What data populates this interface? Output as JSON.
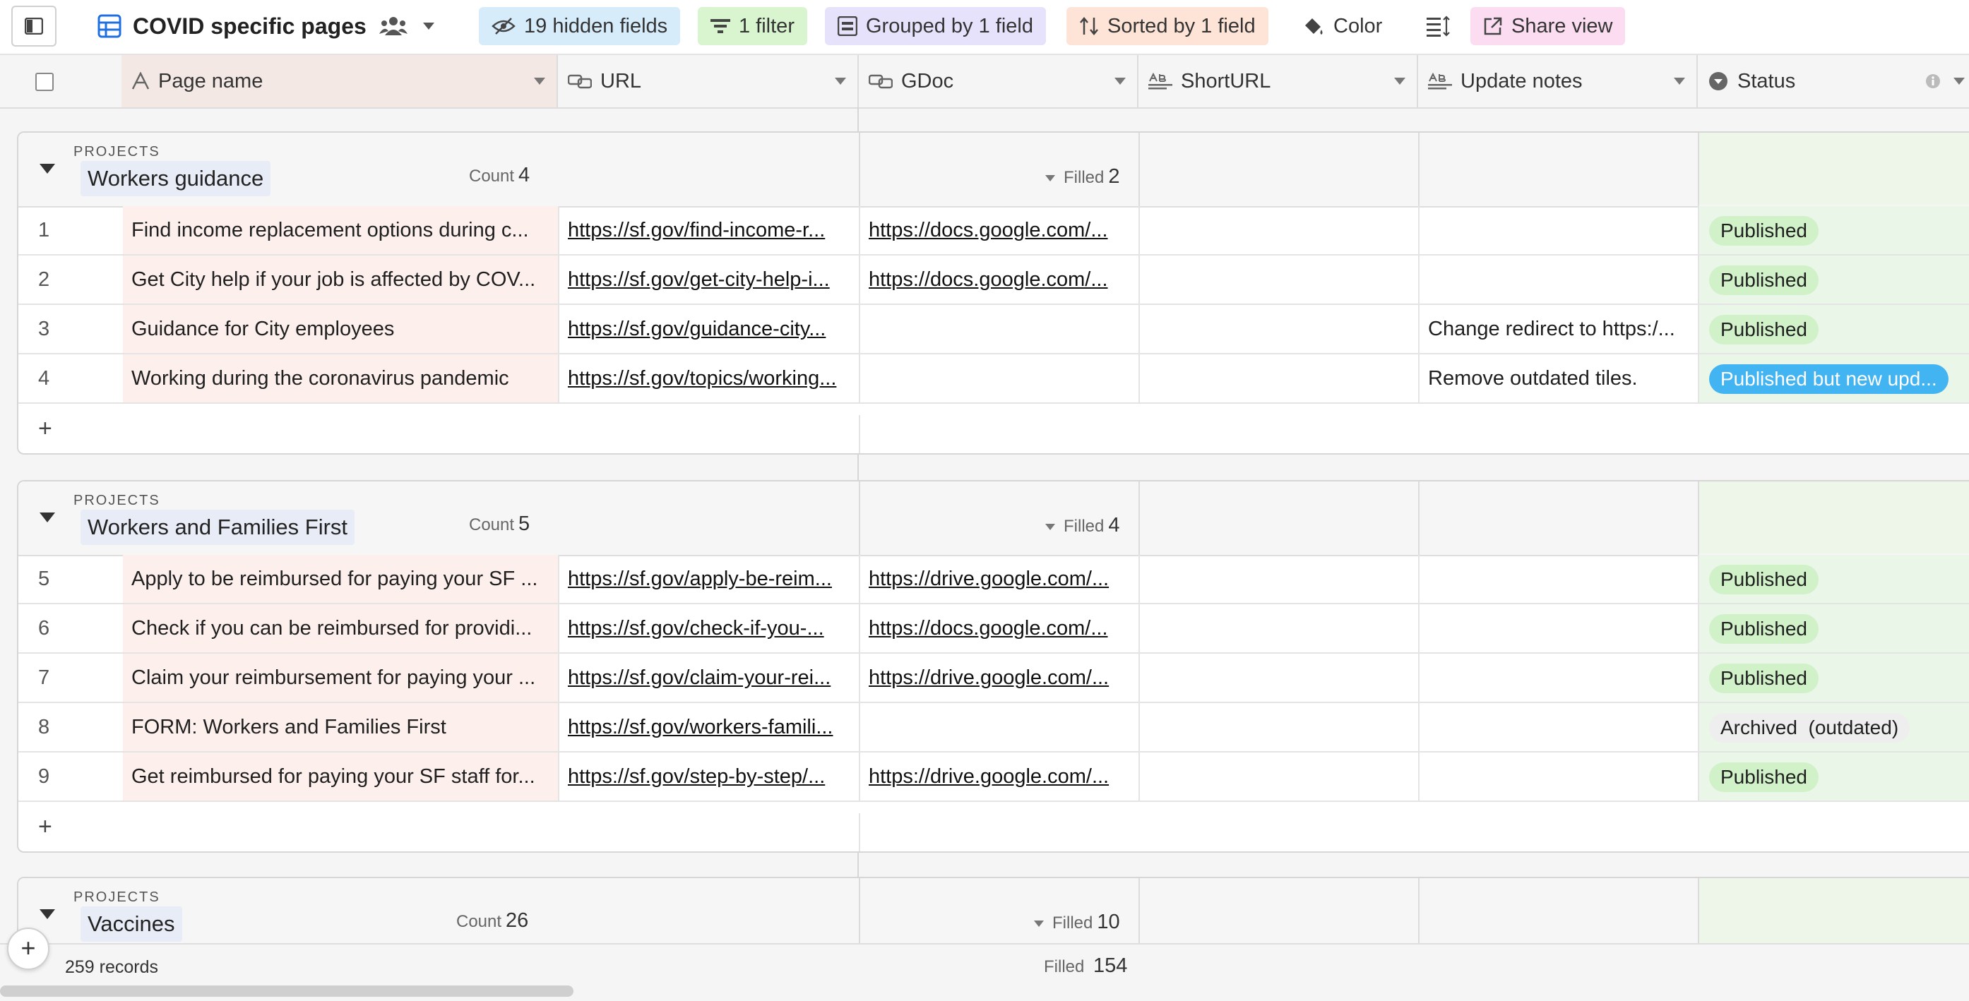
{
  "toolbar": {
    "view_title": "COVID specific pages",
    "hidden_fields": "19 hidden fields",
    "filter": "1 filter",
    "grouped": "Grouped by 1 field",
    "sorted": "Sorted by 1 field",
    "color": "Color",
    "share": "Share view"
  },
  "columns": {
    "page_name": "Page name",
    "url": "URL",
    "gdoc": "GDoc",
    "shorturl": "ShortURL",
    "update_notes": "Update notes",
    "status": "Status"
  },
  "colors": {
    "published": "#d1f1c9",
    "published_new": "#43b4f2",
    "archived": "#eeeeee",
    "hidden_fields_bg": "#d6ecfb",
    "filter_bg": "#d9f5d0",
    "grouped_bg": "#e7e2fb",
    "sorted_bg": "#fde4d6",
    "share_bg": "#fbdcf0"
  },
  "groups": [
    {
      "label": "PROJECTS",
      "name": "Workers guidance",
      "count_label": "Count",
      "count": "4",
      "filled_label": "Filled",
      "filled": "2",
      "rows": [
        {
          "num": "1",
          "page": "Find income replacement options during c...",
          "url": "https://sf.gov/find-income-r...",
          "gdoc": "https://docs.google.com/...",
          "notes": "",
          "status": "Published",
          "status_kind": "published"
        },
        {
          "num": "2",
          "page": "Get City help if your job is affected by COV...",
          "url": "https://sf.gov/get-city-help-i...",
          "gdoc": "https://docs.google.com/...",
          "notes": "",
          "status": "Published",
          "status_kind": "published"
        },
        {
          "num": "3",
          "page": "Guidance for City employees",
          "url": "https://sf.gov/guidance-city...",
          "gdoc": "",
          "notes": "Change redirect to https:/...",
          "status": "Published",
          "status_kind": "published"
        },
        {
          "num": "4",
          "page": "Working during the coronavirus pandemic",
          "url": "https://sf.gov/topics/working...",
          "gdoc": "",
          "notes": "Remove outdated tiles.",
          "status": "Published but new upd...",
          "status_kind": "published_new"
        }
      ]
    },
    {
      "label": "PROJECTS",
      "name": "Workers and Families First",
      "count_label": "Count",
      "count": "5",
      "filled_label": "Filled",
      "filled": "4",
      "rows": [
        {
          "num": "5",
          "page": "Apply to be reimbursed for paying your SF ...",
          "url": "https://sf.gov/apply-be-reim...",
          "gdoc": "https://drive.google.com/...",
          "notes": "",
          "status": "Published",
          "status_kind": "published"
        },
        {
          "num": "6",
          "page": "Check if you can be reimbursed for providi...",
          "url": "https://sf.gov/check-if-you-...",
          "gdoc": "https://docs.google.com/...",
          "notes": "",
          "status": "Published",
          "status_kind": "published"
        },
        {
          "num": "7",
          "page": "Claim your reimbursement for paying your ...",
          "url": "https://sf.gov/claim-your-rei...",
          "gdoc": "https://drive.google.com/...",
          "notes": "",
          "status": "Published",
          "status_kind": "published"
        },
        {
          "num": "8",
          "page": "FORM: Workers and Families First",
          "url": "https://sf.gov/workers-famili...",
          "gdoc": "",
          "notes": "",
          "status": "Archived  (outdated)",
          "status_kind": "archived"
        },
        {
          "num": "9",
          "page": "Get reimbursed for paying your SF staff for...",
          "url": "https://sf.gov/step-by-step/...",
          "gdoc": "https://drive.google.com/...",
          "notes": "",
          "status": "Published",
          "status_kind": "published"
        }
      ]
    },
    {
      "label": "PROJECTS",
      "name": "Vaccines",
      "count_label": "Count",
      "count": "26",
      "filled_label": "Filled",
      "filled": "10",
      "rows": []
    }
  ],
  "add_row": "+",
  "footer": {
    "records": "259 records",
    "filled_label": "Filled",
    "filled": "154",
    "add": "+"
  }
}
